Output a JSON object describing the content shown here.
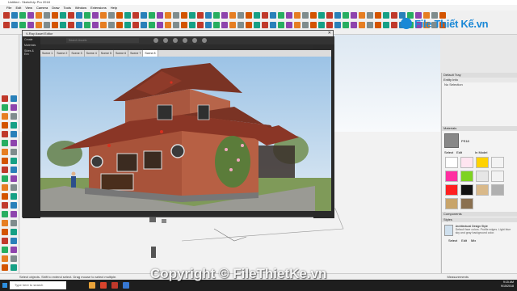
{
  "window": {
    "title": "Untitled - SketchUp Pro 2018"
  },
  "menu": [
    "File",
    "Edit",
    "View",
    "Camera",
    "Draw",
    "Tools",
    "Window",
    "Extensions",
    "Help"
  ],
  "logo": {
    "text": "File Thiết Kế.vn"
  },
  "vray": {
    "title": "V-Ray Asset Editor",
    "left_items": [
      "Create",
      "Materials",
      "Skies & Env"
    ],
    "search_placeholder": "Search Assets",
    "scene_tabs": [
      "Scene 1",
      "Scene 2",
      "Scene 3",
      "Scene 4",
      "Scene 5",
      "Scene 6",
      "Scene 7",
      "Scene 8"
    ],
    "active_scene": "Scene 8"
  },
  "tray": {
    "title": "Default Tray",
    "entity_info": "Entity Info",
    "no_selection": "No Selection",
    "materials": "Materials",
    "material_name": "PS18",
    "select_label": "Select",
    "edit_label": "Edit",
    "material_filter": "In Model",
    "components": "Components",
    "styles": "Styles",
    "style_name": "Architectural Design Style",
    "style_desc": "Default face colors. Profile edges. Light blue sky and gray background color.",
    "styles_tabs": [
      "Select",
      "Edit",
      "Mix"
    ],
    "swatch_colors": [
      "#ffffff",
      "#ffe5f0",
      "#ffd200",
      "#f3f3f3",
      "#ff2fa0",
      "#7ed321",
      "#e6e6e6",
      "#f2f2f2",
      "#ff2020",
      "#111111",
      "#d9b98a",
      "#b0b0b0",
      "#c8a46a",
      "#8a7050"
    ]
  },
  "status": {
    "hint": "Select objects. Shift to extend select. Drag mouse to select multiple.",
    "measurements_label": "Measurements"
  },
  "taskbar": {
    "search": "Type here to search",
    "time": "9:15 AM",
    "date": "9/15/2018"
  },
  "watermark": {
    "text": "Copyright © FileThietKe.vn"
  },
  "colors": {
    "accent": "#1a88d6",
    "vray_bg": "#2b2b2b"
  }
}
